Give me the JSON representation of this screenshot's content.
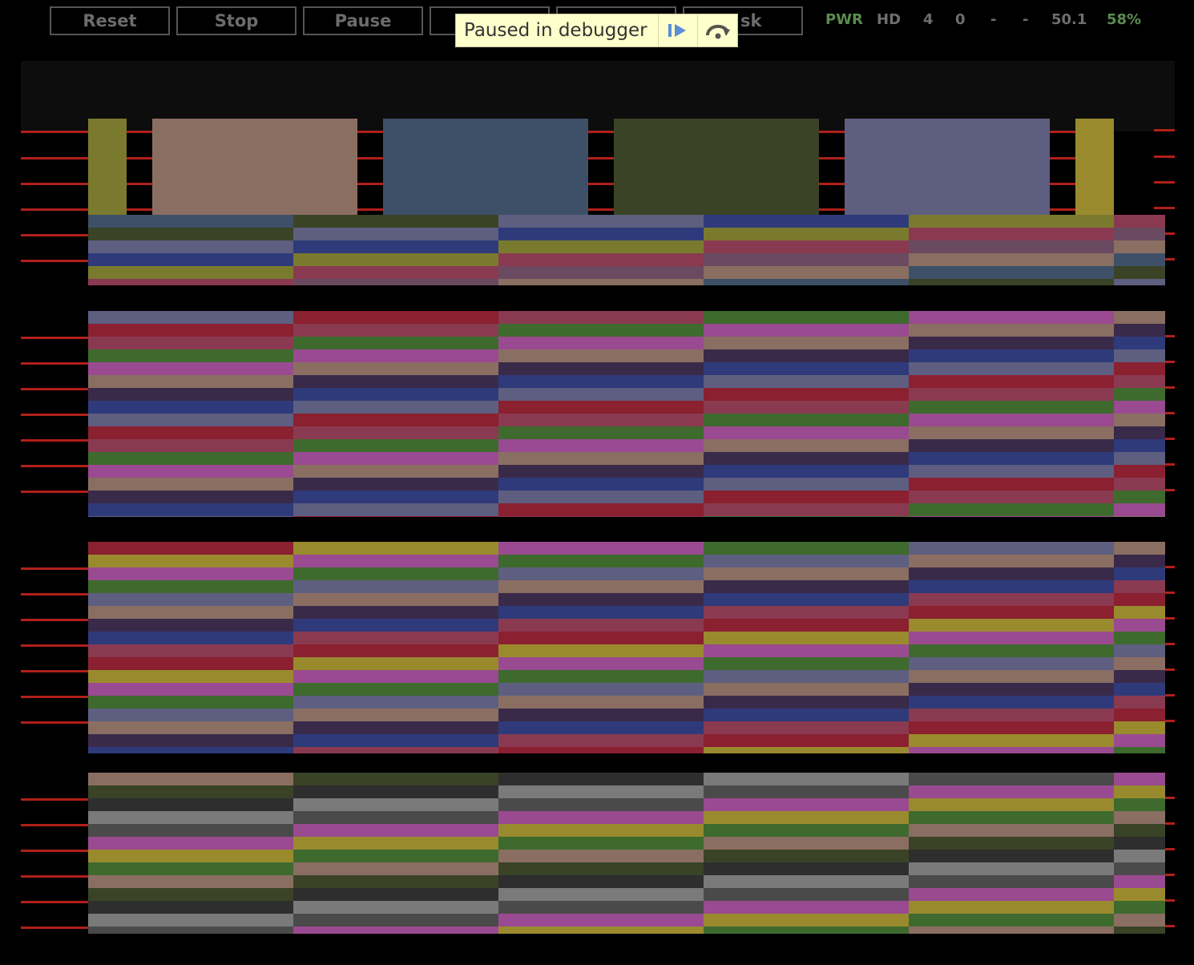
{
  "toolbar": {
    "buttons": [
      "Reset",
      "Stop",
      "Pause",
      "",
      "",
      "sk"
    ],
    "status": {
      "pwr": "PWR",
      "hd": "HD",
      "val1": "4",
      "val2": "0",
      "val3": "-",
      "val4": "-",
      "speed": "50.1",
      "percent": "58%"
    }
  },
  "debugger": {
    "message": "Paused in debugger",
    "resume_icon": "resume-icon",
    "step_over_icon": "step-over-icon"
  },
  "colors": {
    "olive": "#7a7a2e",
    "tan": "#8a6e62",
    "slate": "#3d5068",
    "darkgreen": "#3a4326",
    "lavender": "#5e5e80",
    "gold": "#9a8a2e",
    "red_line": "#b0201a"
  }
}
